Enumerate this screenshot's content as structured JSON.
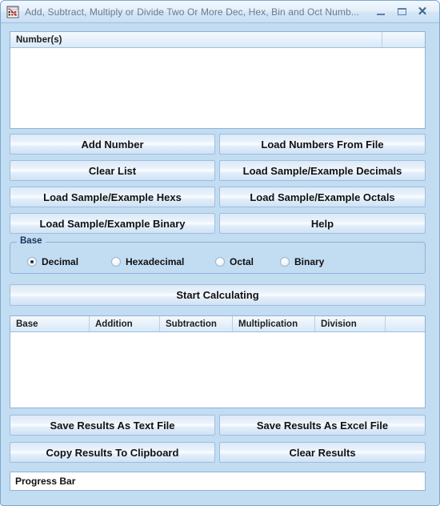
{
  "window": {
    "title": "Add, Subtract, Multiply or Divide Two Or More Dec, Hex, Bin and Oct Numb...",
    "icon": "calculator-grid-icon",
    "minimize_label": "–",
    "maximize_label": "□",
    "close_label": "✕"
  },
  "numbers_list": {
    "columns": [
      "Number(s)",
      ""
    ],
    "rows": []
  },
  "buttons": {
    "add_number": "Add Number",
    "load_numbers_from_file": "Load Numbers From File",
    "clear_list": "Clear List",
    "load_sample_decimals": "Load Sample/Example Decimals",
    "load_sample_hexes": "Load Sample/Example Hexs",
    "load_sample_octals": "Load Sample/Example Octals",
    "load_sample_binary": "Load Sample/Example Binary",
    "help": "Help",
    "start_calculating": "Start Calculating",
    "save_text_file": "Save Results As Text File",
    "save_excel_file": "Save Results As Excel File",
    "copy_clipboard": "Copy Results To Clipboard",
    "clear_results": "Clear Results"
  },
  "base_group": {
    "legend": "Base",
    "options": [
      {
        "label": "Decimal",
        "checked": true
      },
      {
        "label": "Hexadecimal",
        "checked": false
      },
      {
        "label": "Octal",
        "checked": false
      },
      {
        "label": "Binary",
        "checked": false
      }
    ]
  },
  "results_list": {
    "columns": [
      "Base",
      "Addition",
      "Subtraction",
      "Multiplication",
      "Division",
      ""
    ],
    "rows": []
  },
  "progress_bar": {
    "text": "Progress Bar"
  },
  "colors": {
    "window_bg": "#c2dcf2",
    "border": "#8fb4d4",
    "title_text": "#6a7b8d",
    "button_text": "#111111"
  }
}
